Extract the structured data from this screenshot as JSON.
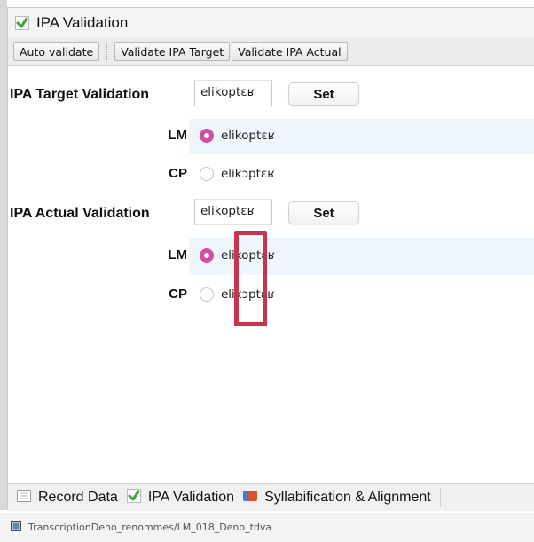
{
  "window": {
    "title": "IPA Validation"
  },
  "toolbar": {
    "auto_validate": "Auto validate",
    "validate_target": "Validate IPA Target",
    "validate_actual": "Validate IPA Actual"
  },
  "target_section": {
    "label": "IPA Target Validation",
    "field_value": "elikoptɛʁ",
    "set_label": "Set",
    "options": [
      {
        "speaker": "LM",
        "value": "elikoptɛʁ",
        "selected": true
      },
      {
        "speaker": "CP",
        "value": "elikɔptɛʁ",
        "selected": false
      }
    ]
  },
  "actual_section": {
    "label": "IPA Actual Validation",
    "field_value": "elikoptɛʁ",
    "set_label": "Set",
    "options": [
      {
        "speaker": "LM",
        "value": "elikoptɛʁ",
        "selected": true
      },
      {
        "speaker": "CP",
        "value": "elikɔptɛʁ",
        "selected": false
      }
    ]
  },
  "bottom_tabs": [
    {
      "label": "Record Data",
      "icon": "record-data-icon"
    },
    {
      "label": "IPA Validation",
      "icon": "check-icon",
      "selected": true
    },
    {
      "label": "Syllabification & Alignment",
      "icon": "syllabification-icon"
    }
  ],
  "status": {
    "path": "TranscriptionDeno_renommes/LM_018_Deno_tdva"
  },
  "colors": {
    "accent": "#d04fa6",
    "highlight_row": "#eef5fb",
    "annotation_box": "#c8334e",
    "check_green": "#3aa33a"
  }
}
